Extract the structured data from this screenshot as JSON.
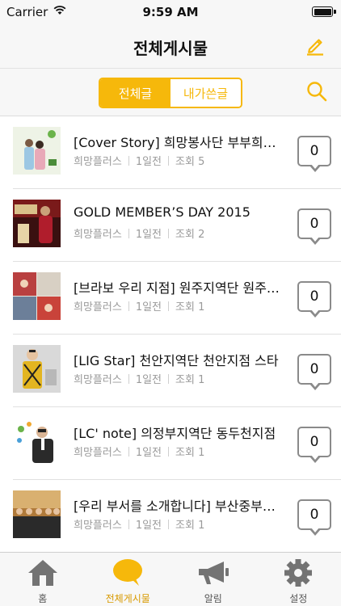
{
  "status_bar": {
    "carrier": "Carrier",
    "time": "9:59 AM"
  },
  "nav": {
    "title": "전체게시물",
    "compose_icon": "pencil-icon"
  },
  "segment": {
    "all_label": "전체글",
    "mine_label": "내가쓴글",
    "selected": "all",
    "search_icon": "search-icon"
  },
  "colors": {
    "accent": "#f6b80b",
    "meta_text": "#9a9a9a"
  },
  "posts": [
    {
      "title": "[Cover Story] 희망봉사단 부부희망봉사단",
      "author": "희망플러스",
      "time": "1일전",
      "views": "조회 5",
      "comments": "0"
    },
    {
      "title": "GOLD MEMBER’S DAY 2015",
      "author": "희망플러스",
      "time": "1일전",
      "views": "조회 2",
      "comments": "0"
    },
    {
      "title": "[브라보 우리 지점] 원주지역단 원주지점",
      "author": "희망플러스",
      "time": "1일전",
      "views": "조회 1",
      "comments": "0"
    },
    {
      "title": "[LIG Star] 천안지역단 천안지점 스타",
      "author": "희망플러스",
      "time": "1일전",
      "views": "조회 1",
      "comments": "0"
    },
    {
      "title": "[LC' note] 의정부지역단 동두천지점",
      "author": "희망플러스",
      "time": "1일전",
      "views": "조회 1",
      "comments": "0"
    },
    {
      "title": "[우리 부서를 소개합니다] 부산중부지역단",
      "author": "희망플러스",
      "time": "1일전",
      "views": "조회 1",
      "comments": "0"
    }
  ],
  "tabs": [
    {
      "label": "홈",
      "icon": "home-icon"
    },
    {
      "label": "전체게시물",
      "icon": "chat-bubble-icon"
    },
    {
      "label": "알림",
      "icon": "megaphone-icon"
    },
    {
      "label": "설정",
      "icon": "gear-icon"
    }
  ],
  "active_tab": 1
}
